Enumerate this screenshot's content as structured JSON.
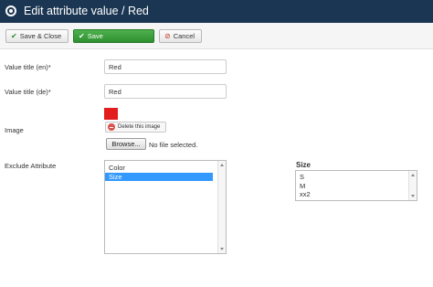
{
  "title_bar": {
    "title": "Edit attribute value / Red",
    "icon": "circle-dot-icon"
  },
  "toolbar": {
    "save_close_label": "Save & Close",
    "save_label": "Save",
    "cancel_label": "Cancel"
  },
  "form": {
    "title_en_label": "Value title (en)*",
    "title_en_value": "Red",
    "title_de_label": "Value title (de)*",
    "title_de_value": "Red",
    "image_label": "Image",
    "image_swatch_color": "#e21d1d",
    "delete_image_label": "Delete this image",
    "browse_label": "Browse...",
    "file_status": "No file selected.",
    "exclude_label": "Exclude Attribute",
    "exclude_options": [
      "Color",
      "Size"
    ],
    "exclude_selected": "Size",
    "size_heading": "Size",
    "size_options": [
      "S",
      "M",
      "xx2"
    ]
  },
  "colors": {
    "title_bar_bg": "#1b3652",
    "save_button": "#3a9d3a",
    "selected_option": "#3399ff"
  }
}
